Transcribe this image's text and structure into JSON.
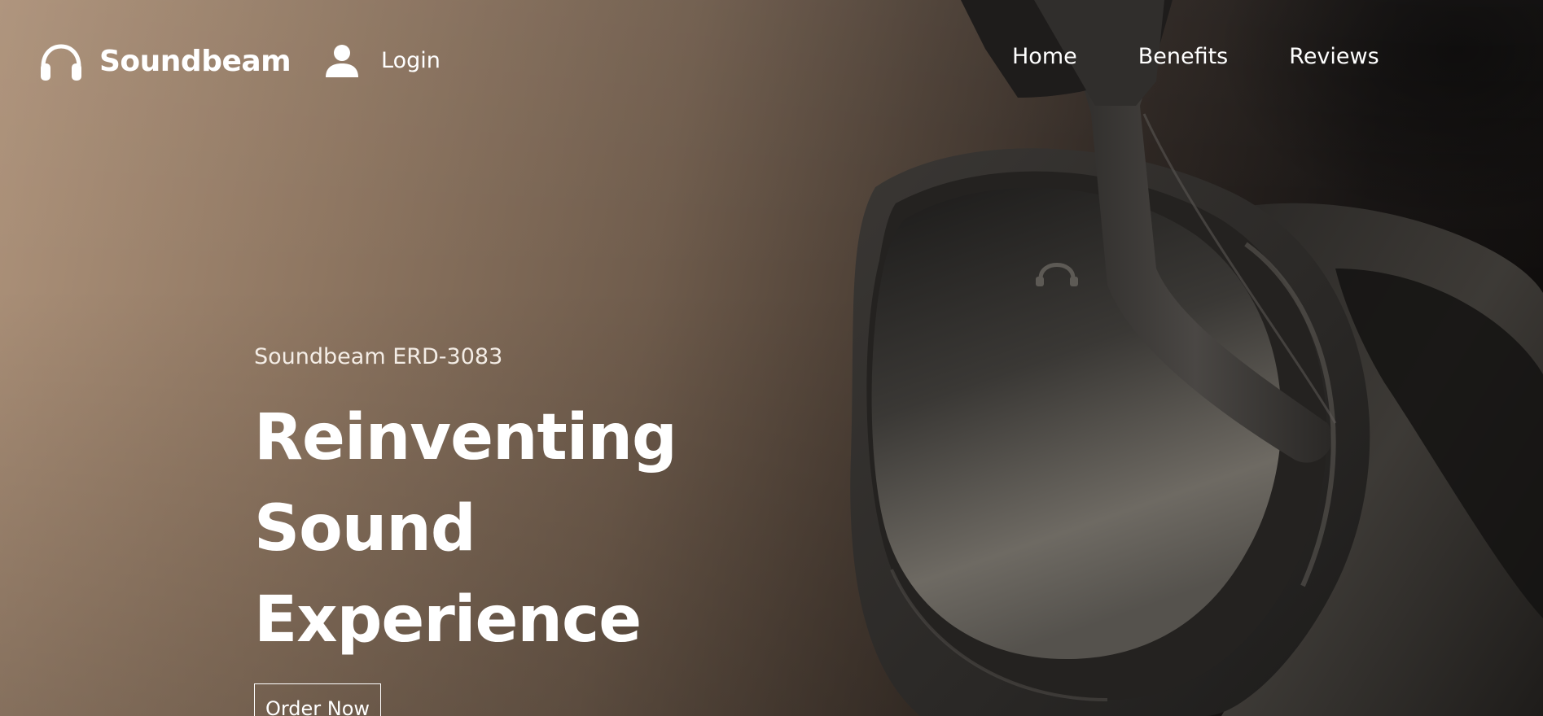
{
  "brand": {
    "name": "Soundbeam",
    "icon": "headphones-icon"
  },
  "header": {
    "login_label": "Login",
    "login_icon": "user-icon",
    "nav": [
      {
        "label": "Home"
      },
      {
        "label": "Benefits"
      },
      {
        "label": "Reviews"
      }
    ]
  },
  "hero": {
    "eyebrow": "Soundbeam ERD-3083",
    "headline_line1": "Reinventing",
    "headline_line2": "Sound Experience",
    "cta_label": "Order Now"
  },
  "colors": {
    "text": "#ffffff",
    "background_light": "#ad927a",
    "background_dark": "#0e0c0b"
  }
}
